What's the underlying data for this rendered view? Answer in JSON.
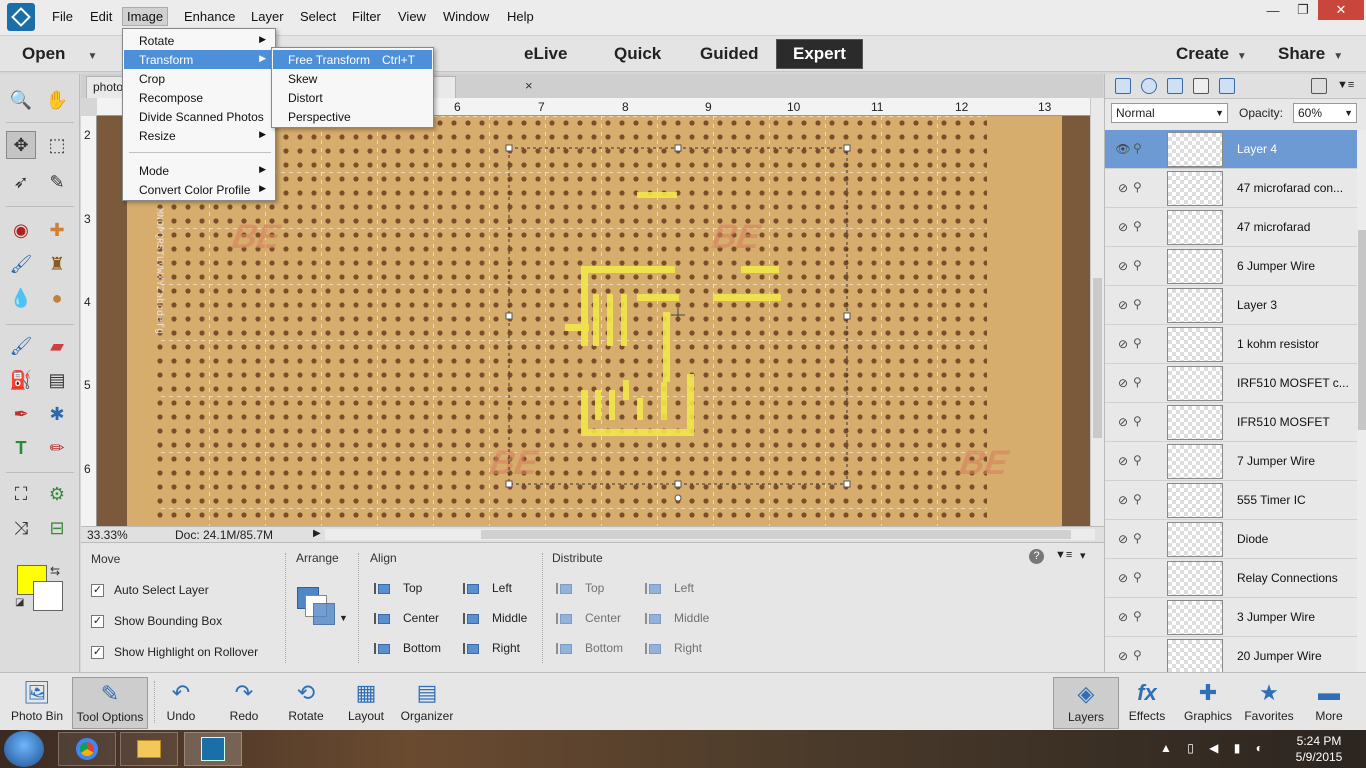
{
  "menubar": {
    "items": [
      "File",
      "Edit",
      "Image",
      "Enhance",
      "Layer",
      "Select",
      "Filter",
      "View",
      "Window",
      "Help"
    ],
    "window_controls": {
      "minimize": "—",
      "restore": "❐",
      "close": "✕"
    }
  },
  "modebar": {
    "open_label": "Open",
    "modes": [
      "eLive",
      "Quick",
      "Guided",
      "Expert"
    ],
    "create_label": "Create",
    "share_label": "Share"
  },
  "document": {
    "tab_label": "photo",
    "tab_close": "×",
    "ruler_top": [
      "6",
      "7",
      "8",
      "9",
      "10",
      "11",
      "12",
      "13"
    ],
    "ruler_left": [
      "2",
      "3",
      "4",
      "5",
      "6"
    ],
    "zoom": "33.33%",
    "doc_size": "Doc: 24.1M/85.7M"
  },
  "image_menu": {
    "items": [
      "Rotate",
      "Transform",
      "Crop",
      "Recompose",
      "Divide Scanned Photos",
      "Resize",
      "Mode",
      "Convert Color Profile"
    ],
    "highlighted": "Transform"
  },
  "transform_submenu": {
    "items": [
      {
        "label": "Free Transform",
        "shortcut": "Ctrl+T"
      },
      {
        "label": "Skew",
        "shortcut": ""
      },
      {
        "label": "Distort",
        "shortcut": ""
      },
      {
        "label": "Perspective",
        "shortcut": ""
      }
    ],
    "highlighted": "Free Transform"
  },
  "colors": {
    "foreground": "#ffff00",
    "background": "#ffffff",
    "accent": "#4d8fd8"
  },
  "tool_options": {
    "move_heading": "Move",
    "auto_select": "Auto Select Layer",
    "show_bounding_box": "Show Bounding Box",
    "show_highlight": "Show Highlight on Rollover",
    "arrange_heading": "Arrange",
    "align_heading": "Align",
    "align_items": [
      "Top",
      "Center",
      "Bottom",
      "Left",
      "Middle",
      "Right"
    ],
    "distribute_heading": "Distribute",
    "distribute_items": [
      "Top",
      "Center",
      "Bottom",
      "Left",
      "Middle",
      "Right"
    ]
  },
  "layers": {
    "blend_mode": "Normal",
    "opacity_label": "Opacity:",
    "opacity_value": "60%",
    "items": [
      {
        "name": "Layer 4",
        "selected": true,
        "visible": true
      },
      {
        "name": "47 microfarad con...",
        "selected": false,
        "visible": false
      },
      {
        "name": "47 microfarad",
        "selected": false,
        "visible": false
      },
      {
        "name": "6 Jumper Wire",
        "selected": false,
        "visible": false
      },
      {
        "name": "Layer 3",
        "selected": false,
        "visible": false
      },
      {
        "name": "1 kohm resistor",
        "selected": false,
        "visible": false
      },
      {
        "name": "IRF510 MOSFET c...",
        "selected": false,
        "visible": false
      },
      {
        "name": "IFR510 MOSFET",
        "selected": false,
        "visible": false
      },
      {
        "name": "7 Jumper Wire",
        "selected": false,
        "visible": false
      },
      {
        "name": "555 Timer IC",
        "selected": false,
        "visible": false
      },
      {
        "name": "Diode",
        "selected": false,
        "visible": false
      },
      {
        "name": "Relay Connections",
        "selected": false,
        "visible": false
      },
      {
        "name": "3 Jumper Wire",
        "selected": false,
        "visible": false
      },
      {
        "name": "20 Jumper Wire",
        "selected": false,
        "visible": false
      }
    ]
  },
  "panelbar": {
    "left": [
      "Photo Bin",
      "Tool Options",
      "Undo",
      "Redo",
      "Rotate",
      "Layout",
      "Organizer"
    ],
    "right": [
      "Layers",
      "Effects",
      "Graphics",
      "Favorites",
      "More"
    ]
  },
  "taskbar": {
    "time": "5:24 PM",
    "date": "5/9/2015"
  }
}
